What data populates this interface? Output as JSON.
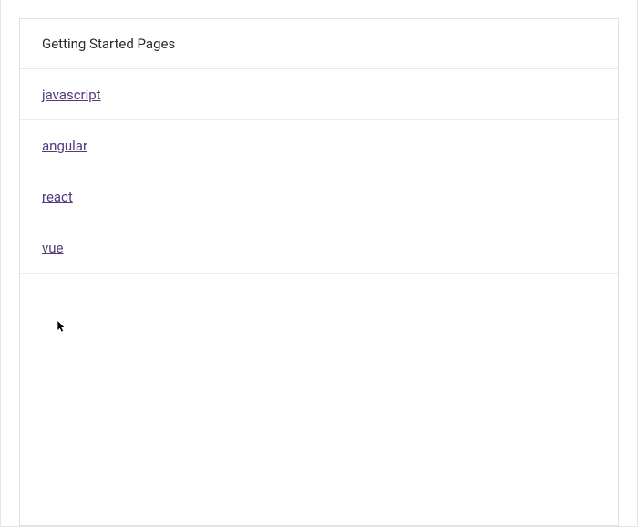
{
  "panel": {
    "title": "Getting Started Pages",
    "items": [
      {
        "label": "javascript"
      },
      {
        "label": "angular"
      },
      {
        "label": "react"
      },
      {
        "label": "vue"
      }
    ]
  }
}
